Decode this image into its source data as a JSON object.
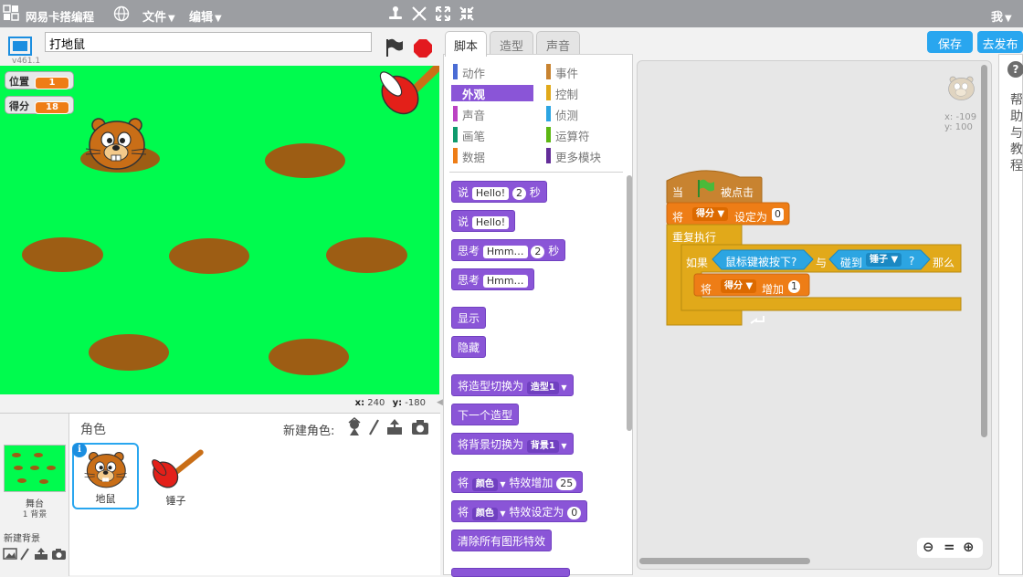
{
  "topbar": {
    "brand": "网易卡搭编程",
    "menus": [
      {
        "label": "文件"
      },
      {
        "label": "编辑"
      }
    ],
    "user": "我"
  },
  "stage": {
    "version": "v461.1",
    "project_title": "打地鼠",
    "monitors": [
      {
        "label": "位置",
        "value": "1"
      },
      {
        "label": "得分",
        "value": "18"
      }
    ],
    "coords": {
      "x_label": "x:",
      "x": "240",
      "y_label": "y:",
      "y": "-180"
    },
    "colors": {
      "background": "#00fb4e",
      "hole": "#9d5d14",
      "mole": "#c96e17"
    }
  },
  "sprite_pane": {
    "header": "角色",
    "new_sprite": "新建角色:",
    "stage_label": "舞台",
    "stage_backdrops": "1 背景",
    "new_backdrop": "新建背景",
    "sprites": [
      {
        "name": "地鼠",
        "selected": true
      },
      {
        "name": "锤子",
        "selected": false
      }
    ]
  },
  "tabs": [
    {
      "label": "脚本"
    },
    {
      "label": "造型"
    },
    {
      "label": "声音"
    }
  ],
  "categories": [
    {
      "label": "动作",
      "color": "#4a6cd4"
    },
    {
      "label": "事件",
      "color": "#c88330"
    },
    {
      "label": "外观",
      "color": "#8a55d7"
    },
    {
      "label": "控制",
      "color": "#e1a91a"
    },
    {
      "label": "声音",
      "color": "#bb42c3"
    },
    {
      "label": "侦测",
      "color": "#2ca5e2"
    },
    {
      "label": "画笔",
      "color": "#0e9a6c"
    },
    {
      "label": "运算符",
      "color": "#5cb712"
    },
    {
      "label": "数据",
      "color": "#ee7d16"
    },
    {
      "label": "更多模块",
      "color": "#632d99"
    }
  ],
  "palette_blocks": {
    "say_secs": {
      "a": "说",
      "msg": "Hello!",
      "num": "2",
      "b": "秒"
    },
    "say": {
      "a": "说",
      "msg": "Hello!"
    },
    "think_secs": {
      "a": "思考",
      "msg": "Hmm…",
      "num": "2",
      "b": "秒"
    },
    "think": {
      "a": "思考",
      "msg": "Hmm…"
    },
    "show": "显示",
    "hide": "隐藏",
    "switch_costume": {
      "a": "将造型切换为",
      "dd": "造型1"
    },
    "next_costume": "下一个造型",
    "switch_backdrop": {
      "a": "将背景切换为",
      "dd": "背景1"
    },
    "change_effect": {
      "a": "将",
      "dd": "颜色",
      "b": "特效增加",
      "num": "25"
    },
    "set_effect": {
      "a": "将",
      "dd": "颜色",
      "b": "特效设定为",
      "num": "0"
    },
    "clear_effects": "清除所有图形特效"
  },
  "script": {
    "hat": {
      "a": "当",
      "b": "被点击"
    },
    "set_var": {
      "a": "将",
      "var": "得分",
      "b": "设定为",
      "val": "0"
    },
    "forever": "重复执行",
    "if": {
      "a": "如果",
      "cond1": "鼠标键被按下?",
      "and": "与",
      "touch": "碰到",
      "target": "锤子",
      "q": "?",
      "then": "那么"
    },
    "change_var": {
      "a": "将",
      "var": "得分",
      "b": "增加",
      "val": "1"
    },
    "sprite_xy": {
      "x": "x: -109",
      "y": "y: 100"
    }
  },
  "buttons": {
    "save": "保存",
    "publish": "去发布"
  },
  "help": {
    "q": "?",
    "text": "帮助与教程"
  }
}
